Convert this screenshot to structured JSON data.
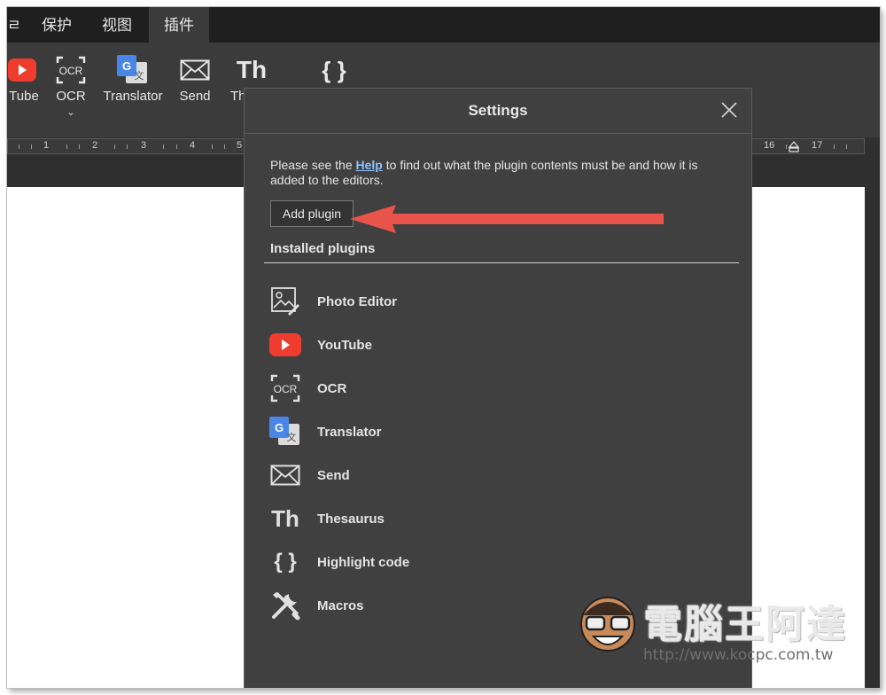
{
  "menu": {
    "tabs": [
      {
        "label": "ㄹ"
      },
      {
        "label": "保护"
      },
      {
        "label": "视图"
      },
      {
        "label": "插件"
      }
    ]
  },
  "ribbon": {
    "buttons": [
      {
        "label": "Tube",
        "icon": "youtube-icon"
      },
      {
        "label": "OCR",
        "icon": "ocr-icon"
      },
      {
        "label": "Translator",
        "icon": "translator-icon"
      },
      {
        "label": "Send",
        "icon": "envelope-icon"
      },
      {
        "label": "Th",
        "icon": "thesaurus-icon"
      },
      {
        "label": "",
        "icon": "braces-icon"
      }
    ],
    "th_glyph": "Th",
    "braces_glyph": "{ }",
    "ocr_glyph": "OCR"
  },
  "ruler": {
    "left_numbers": [
      "1",
      "2",
      "3",
      "4",
      "5"
    ],
    "right_numbers": [
      "16",
      "17"
    ]
  },
  "dialog": {
    "title": "Settings",
    "desc_before": "Please see the ",
    "help_link": "Help",
    "desc_after": " to find out what the plugin contents must be and how it is added to the editors.",
    "add_plugin_label": "Add plugin",
    "installed_heading": "Installed plugins",
    "plugins": [
      {
        "label": "Photo Editor",
        "icon": "photo-editor-icon"
      },
      {
        "label": "YouTube",
        "icon": "youtube-icon"
      },
      {
        "label": "OCR",
        "icon": "ocr-icon"
      },
      {
        "label": "Translator",
        "icon": "translator-icon"
      },
      {
        "label": "Send",
        "icon": "envelope-icon"
      },
      {
        "label": "Thesaurus",
        "icon": "thesaurus-icon"
      },
      {
        "label": "Highlight code",
        "icon": "braces-icon"
      },
      {
        "label": "Macros",
        "icon": "tools-icon"
      }
    ]
  },
  "watermark": {
    "text": "電腦王阿達",
    "url": "http://www.kocpc.com.tw"
  },
  "colors": {
    "accent_red": "#e8534a",
    "youtube_red": "#f03c2e",
    "google_blue": "#4a86e8",
    "link_blue": "#8fc1ff"
  }
}
